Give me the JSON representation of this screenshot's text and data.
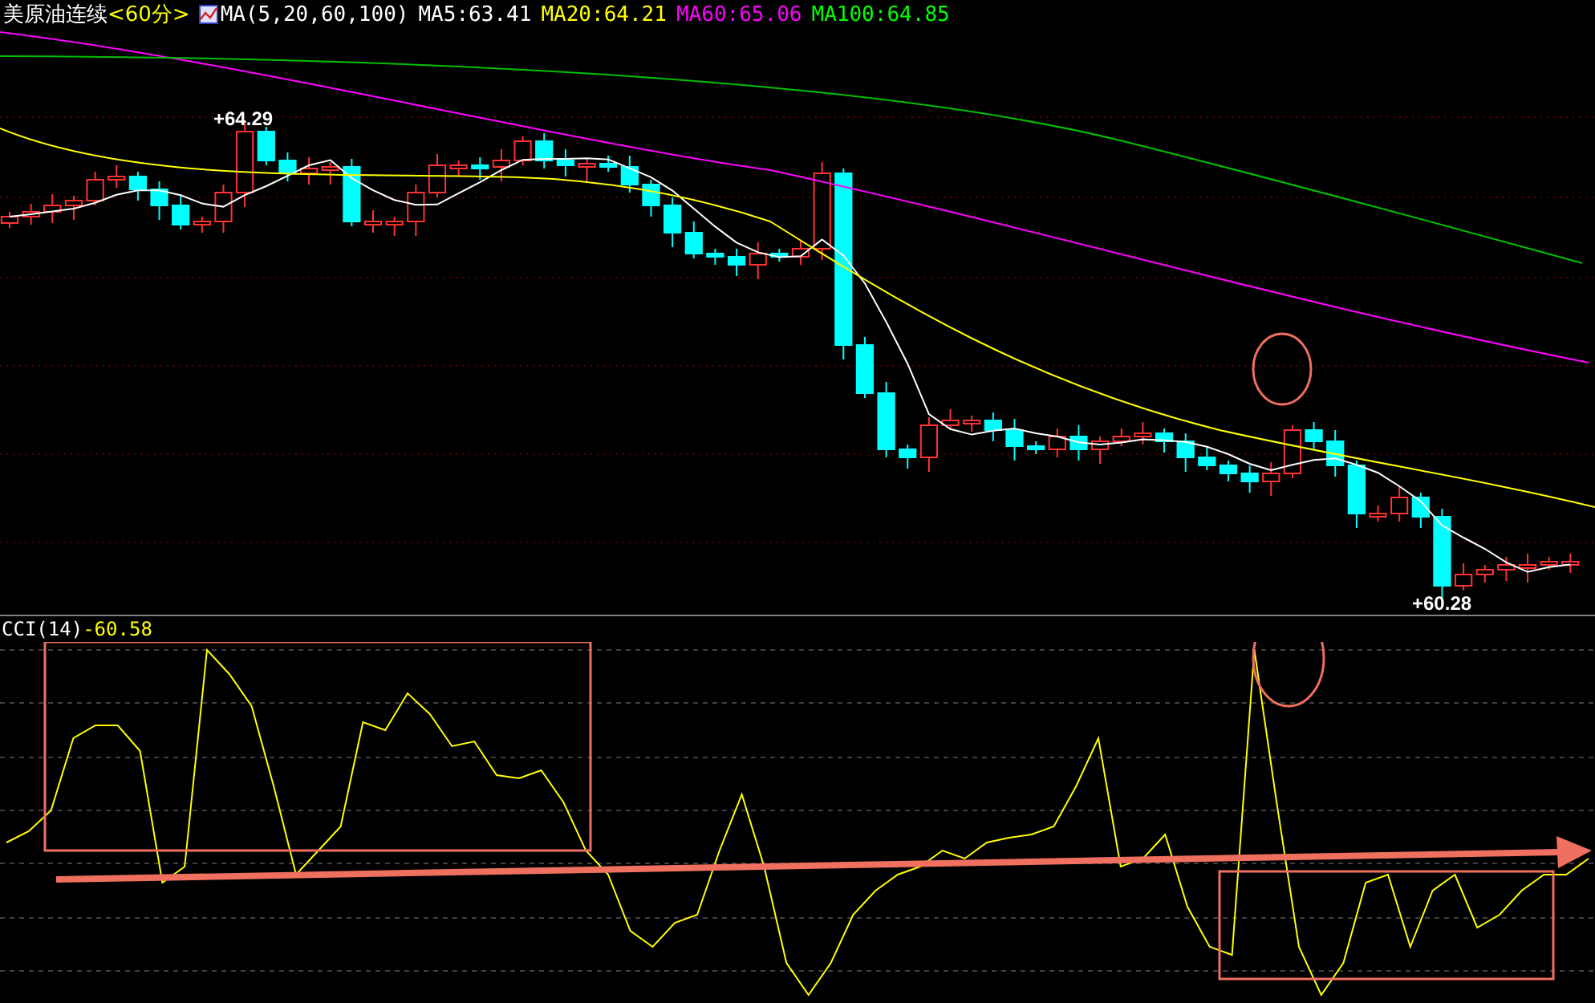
{
  "header": {
    "title": "美原油连续",
    "period": "<60分>",
    "indicator": "MA(5,20,60,100)",
    "averages": [
      {
        "label": "MA5:63.41",
        "color": "#ffffff"
      },
      {
        "label": "MA20:64.21",
        "color": "#ffff00"
      },
      {
        "label": "MA60:65.06",
        "color": "#ff00ff"
      },
      {
        "label": "MA100:64.85",
        "color": "#00ff00"
      }
    ]
  },
  "price_panel": {
    "high_label": "+64.29",
    "low_label": "+60.28"
  },
  "cci_panel": {
    "indicator": "CCI(14)",
    "value": "-60.58"
  }
}
